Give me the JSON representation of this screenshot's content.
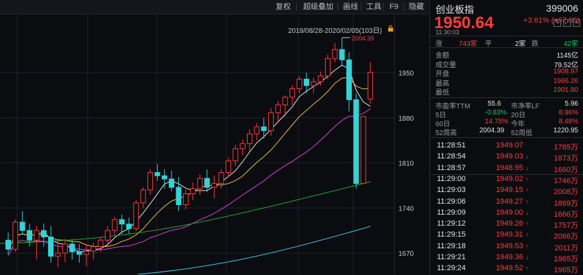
{
  "toolbar": {
    "items": [
      "复权",
      "超级叠加",
      "画线",
      "工具",
      "F9",
      "隐藏"
    ]
  },
  "chart": {
    "date_range": "2019/08/28-2020/02/05(103日)",
    "y_ticks": [
      "1950",
      "1880",
      "1810",
      "1740",
      "1670"
    ],
    "high_annotation": "2004.39",
    "colors": {
      "up": "#ff3b3b",
      "down": "#35d3d6",
      "ma5": "#e8e8e8",
      "ma10": "#f0c040",
      "ma20": "#e040e0",
      "ma60": "#20b030",
      "ma120": "#40c8f0"
    }
  },
  "chart_data": {
    "type": "candlestick",
    "ylim": [
      1640,
      2030
    ],
    "y_ticks": [
      1950,
      1880,
      1810,
      1740,
      1670
    ],
    "candles": [
      {
        "o": 1690,
        "h": 1702,
        "l": 1668,
        "c": 1676
      },
      {
        "o": 1676,
        "h": 1722,
        "l": 1672,
        "c": 1718
      },
      {
        "o": 1718,
        "h": 1735,
        "l": 1700,
        "c": 1705
      },
      {
        "o": 1705,
        "h": 1715,
        "l": 1680,
        "c": 1690
      },
      {
        "o": 1690,
        "h": 1712,
        "l": 1660,
        "c": 1705
      },
      {
        "o": 1705,
        "h": 1716,
        "l": 1680,
        "c": 1695
      },
      {
        "o": 1695,
        "h": 1712,
        "l": 1655,
        "c": 1665
      },
      {
        "o": 1665,
        "h": 1690,
        "l": 1648,
        "c": 1670
      },
      {
        "o": 1670,
        "h": 1692,
        "l": 1656,
        "c": 1684
      },
      {
        "o": 1684,
        "h": 1690,
        "l": 1660,
        "c": 1672
      },
      {
        "o": 1672,
        "h": 1684,
        "l": 1655,
        "c": 1668
      },
      {
        "o": 1668,
        "h": 1684,
        "l": 1650,
        "c": 1673
      },
      {
        "o": 1673,
        "h": 1686,
        "l": 1660,
        "c": 1680
      },
      {
        "o": 1680,
        "h": 1695,
        "l": 1672,
        "c": 1690
      },
      {
        "o": 1690,
        "h": 1712,
        "l": 1680,
        "c": 1705
      },
      {
        "o": 1705,
        "h": 1726,
        "l": 1698,
        "c": 1722
      },
      {
        "o": 1722,
        "h": 1730,
        "l": 1700,
        "c": 1715
      },
      {
        "o": 1715,
        "h": 1725,
        "l": 1700,
        "c": 1708
      },
      {
        "o": 1708,
        "h": 1752,
        "l": 1704,
        "c": 1748
      },
      {
        "o": 1748,
        "h": 1772,
        "l": 1740,
        "c": 1768
      },
      {
        "o": 1768,
        "h": 1800,
        "l": 1760,
        "c": 1795
      },
      {
        "o": 1795,
        "h": 1808,
        "l": 1782,
        "c": 1790
      },
      {
        "o": 1790,
        "h": 1800,
        "l": 1770,
        "c": 1785
      },
      {
        "o": 1785,
        "h": 1798,
        "l": 1766,
        "c": 1772
      },
      {
        "o": 1772,
        "h": 1788,
        "l": 1735,
        "c": 1745
      },
      {
        "o": 1745,
        "h": 1768,
        "l": 1738,
        "c": 1762
      },
      {
        "o": 1762,
        "h": 1780,
        "l": 1752,
        "c": 1770
      },
      {
        "o": 1770,
        "h": 1792,
        "l": 1760,
        "c": 1786
      },
      {
        "o": 1786,
        "h": 1800,
        "l": 1765,
        "c": 1772
      },
      {
        "o": 1772,
        "h": 1790,
        "l": 1755,
        "c": 1778
      },
      {
        "o": 1778,
        "h": 1800,
        "l": 1770,
        "c": 1795
      },
      {
        "o": 1795,
        "h": 1818,
        "l": 1788,
        "c": 1813
      },
      {
        "o": 1813,
        "h": 1838,
        "l": 1805,
        "c": 1832
      },
      {
        "o": 1832,
        "h": 1846,
        "l": 1822,
        "c": 1840
      },
      {
        "o": 1840,
        "h": 1862,
        "l": 1828,
        "c": 1855
      },
      {
        "o": 1855,
        "h": 1872,
        "l": 1845,
        "c": 1866
      },
      {
        "o": 1866,
        "h": 1880,
        "l": 1848,
        "c": 1860
      },
      {
        "o": 1860,
        "h": 1895,
        "l": 1852,
        "c": 1888
      },
      {
        "o": 1888,
        "h": 1906,
        "l": 1872,
        "c": 1900
      },
      {
        "o": 1900,
        "h": 1915,
        "l": 1882,
        "c": 1912
      },
      {
        "o": 1912,
        "h": 1930,
        "l": 1900,
        "c": 1925
      },
      {
        "o": 1925,
        "h": 1945,
        "l": 1918,
        "c": 1940
      },
      {
        "o": 1940,
        "h": 1950,
        "l": 1918,
        "c": 1930
      },
      {
        "o": 1930,
        "h": 1942,
        "l": 1918,
        "c": 1936
      },
      {
        "o": 1936,
        "h": 1952,
        "l": 1930,
        "c": 1945
      },
      {
        "o": 1945,
        "h": 1978,
        "l": 1940,
        "c": 1972
      },
      {
        "o": 1972,
        "h": 1996,
        "l": 1966,
        "c": 1986
      },
      {
        "o": 1986,
        "h": 2004.39,
        "l": 1960,
        "c": 1970
      },
      {
        "o": 1970,
        "h": 1982,
        "l": 1890,
        "c": 1908
      },
      {
        "o": 1908,
        "h": 1918,
        "l": 1770,
        "c": 1778
      },
      {
        "o": 1778,
        "h": 1882,
        "l": 1782,
        "c": 1882
      },
      {
        "o": 1908.97,
        "h": 1966.26,
        "l": 1901.8,
        "c": 1950.64
      }
    ]
  },
  "quote": {
    "name": "创业板指",
    "code": "399006",
    "price": "1950.64",
    "change": "+3.61% (+67.95)",
    "time": "11:30:03",
    "breadth_up_label": "涨",
    "breadth_up": "743家",
    "breadth_flat_label": "平",
    "breadth_flat": "2家",
    "breadth_down_label": "跌",
    "breadth_down": "42家",
    "stats": [
      {
        "label": "金额",
        "value": "1145亿",
        "cls": "white"
      },
      {
        "label": "成交量",
        "value": "79.52亿",
        "cls": "white"
      },
      {
        "label": "开盘",
        "value": "1908.97",
        "cls": "red"
      },
      {
        "label": "最高",
        "value": "1966.26",
        "cls": "red"
      },
      {
        "label": "最低",
        "value": "1901.80",
        "cls": "red"
      }
    ],
    "pe_label": "市盈率TTM",
    "pe_value": "55.6",
    "pb_label": "市净率LF",
    "pb_value": "5.96",
    "d5_label": "5日",
    "d5_value": "-0.83%",
    "d20_label": "20日",
    "d20_value": "8.96%",
    "d60_label": "60日",
    "d60_value": "14.75%",
    "ytd_label": "今年",
    "ytd_value": "8.48%",
    "w52h_label": "52周高",
    "w52h_value": "2004.39",
    "w52l_label": "52周低",
    "w52l_value": "1220.95"
  },
  "ticks": [
    {
      "time": "11:28:51",
      "price": "1949.07",
      "dir": "",
      "vol": "1785万"
    },
    {
      "time": "11:28:54",
      "price": "1949.03",
      "dir": "down",
      "vol": "1873万"
    },
    {
      "time": "11:28:57",
      "price": "1948.95",
      "dir": "down",
      "vol": "1660万"
    },
    {
      "time": "11:29:00",
      "price": "1949.02",
      "dir": "up",
      "vol": "1746万"
    },
    {
      "time": "11:29:03",
      "price": "1949.15",
      "dir": "up",
      "vol": "2008万"
    },
    {
      "time": "11:29:06",
      "price": "1949.27",
      "dir": "up",
      "vol": "1869万"
    },
    {
      "time": "11:29:09",
      "price": "1949.00",
      "dir": "down",
      "vol": "1666万"
    },
    {
      "time": "11:29:12",
      "price": "1949.26",
      "dir": "up",
      "vol": "1757万"
    },
    {
      "time": "11:29:15",
      "price": "1949.31",
      "dir": "up",
      "vol": "2066万"
    },
    {
      "time": "11:29:18",
      "price": "1949.53",
      "dir": "up",
      "vol": "2011万"
    },
    {
      "time": "11:29:21",
      "price": "1949.36",
      "dir": "down",
      "vol": "1965万"
    },
    {
      "time": "11:29:24",
      "price": "1949.52",
      "dir": "up",
      "vol": "1965万"
    }
  ]
}
